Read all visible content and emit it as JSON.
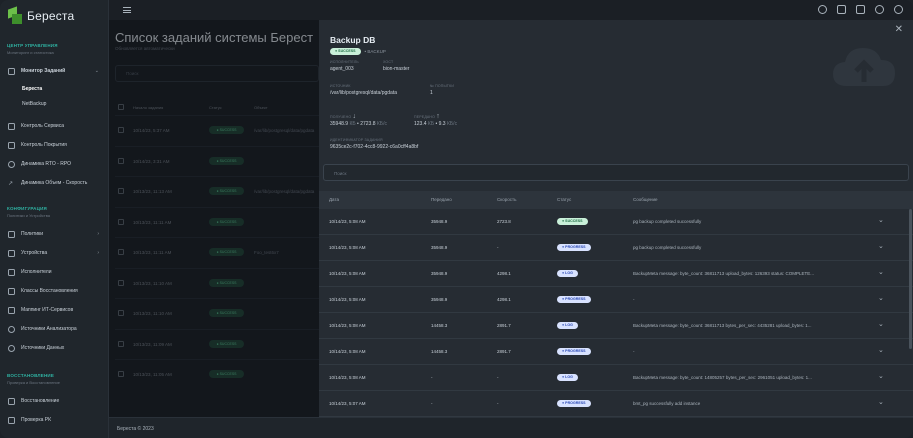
{
  "app": {
    "name": "Береста",
    "footer": "Береста © 2023"
  },
  "sidebar": {
    "sections": [
      {
        "title": "ЦЕНТР УПРАВЛЕНИЯ",
        "subtitle": "Мониторинг и статистика"
      },
      {
        "title": "КОНФИГУРАЦИЯ",
        "subtitle": "Политики и Устройства"
      },
      {
        "title": "ВОССТАНОВЛЕНИЕ",
        "subtitle": "Проверка и Восстановление"
      }
    ],
    "items": [
      {
        "label": "Монитор Заданий",
        "icon": "monitor-icon"
      },
      {
        "label": "Береста",
        "icon": ""
      },
      {
        "label": "NetBackup",
        "icon": ""
      },
      {
        "label": "Контроль Сервиса",
        "icon": "clipboard-icon"
      },
      {
        "label": "Контроль Покрытия",
        "icon": "clipboard-check-icon"
      },
      {
        "label": "Динамика RTO - RPO",
        "icon": "clock-icon"
      },
      {
        "label": "Динамика Объем - Скорость",
        "icon": "trend-icon"
      },
      {
        "label": "Политики",
        "icon": "policy-icon"
      },
      {
        "label": "Устройства",
        "icon": "device-icon"
      },
      {
        "label": "Исполнители",
        "icon": "server-icon"
      },
      {
        "label": "Классы Восстановления",
        "icon": "class-icon"
      },
      {
        "label": "Маппинг ИТ-Сервисов",
        "icon": "mapping-icon"
      },
      {
        "label": "Источники Анализатора",
        "icon": "source-icon"
      },
      {
        "label": "Источники Данных",
        "icon": "database-icon"
      },
      {
        "label": "Восстановление",
        "icon": "restore-icon"
      },
      {
        "label": "Проверка РК",
        "icon": "check-icon"
      }
    ]
  },
  "background": {
    "title": "Список заданий системы Берест",
    "subtitle": "Обновляется автоматически",
    "search_placeholder": "Поиск",
    "headers": [
      "Начало задания",
      "Статус",
      "Объект"
    ],
    "rows": [
      {
        "date": "10/14/23, 5:37 AM",
        "status": "SUCCESS",
        "object": "/var/lib/postgresql/data/pgdata"
      },
      {
        "date": "10/14/23, 3:31 AM",
        "status": "SUCCESS",
        "object": ""
      },
      {
        "date": "10/13/23, 11:13 AM",
        "status": "SUCCESS",
        "object": "/var/lib/postgresql/data/pgdata"
      },
      {
        "date": "10/13/23, 11:11 AM",
        "status": "SUCCESS",
        "object": ""
      },
      {
        "date": "10/13/23, 11:11 AM",
        "status": "SUCCESS",
        "object": "Foo_test6x7"
      },
      {
        "date": "10/13/23, 11:10 AM",
        "status": "SUCCESS",
        "object": ""
      },
      {
        "date": "10/13/23, 11:10 AM",
        "status": "SUCCESS",
        "object": ""
      },
      {
        "date": "10/13/23, 11:09 AM",
        "status": "SUCCESS",
        "object": ""
      },
      {
        "date": "10/13/23, 11:05 AM",
        "status": "SUCCESS",
        "object": ""
      }
    ]
  },
  "drawer": {
    "title": "Backup DB",
    "status": "SUCCESS",
    "type": "BACKUP",
    "executor_label": "ИСПОЛНИТЕЛЬ",
    "executor": "agent_003",
    "host_label": "ХОСТ",
    "host": "bion-master",
    "source_label": "ИСТОЧНИК",
    "source": "/var/lib/postgresql/data/pgdata",
    "attempts_label": "№ ПОПЫТКИ",
    "attempts": "1",
    "processed_label": "ПОЛУЧЕНО",
    "processed": "35948.9",
    "processed_unit": "КБ",
    "processed_speed": "2723.8",
    "processed_speed_unit": "КБ/с",
    "transferred_label": "ПЕРЕДАНО",
    "transferred": "123.4",
    "transferred_unit": "КБ",
    "transferred_speed": "9.3",
    "transferred_speed_unit": "КБ/с",
    "job_id_label": "ИДЕНТИФИКАТОР ЗАДАНИЯ",
    "job_id": "9635ce2c-f702-4cc8-9922-c6a0cff4a8bf",
    "search_placeholder": "Поиск",
    "columns": [
      "Дата",
      "Передано",
      "Скорость",
      "Статус",
      "Сообщение"
    ],
    "rows": [
      {
        "date": "10/14/23, 5:08 AM",
        "transferred": "35948.9",
        "speed": "2723.8",
        "status": "SUCCESS",
        "message": "pg backup completed successfully"
      },
      {
        "date": "10/14/23, 5:08 AM",
        "transferred": "35948.9",
        "speed": "-",
        "status": "PROGRESS",
        "message": "pg backup completed successfully"
      },
      {
        "date": "10/14/23, 5:08 AM",
        "transferred": "35948.9",
        "speed": "4298.1",
        "status": "LOG",
        "message": "BackupMeta message: byte_count: 36811713 upload_bytes: 126393 status: COMPLETE..."
      },
      {
        "date": "10/14/23, 5:08 AM",
        "transferred": "35948.9",
        "speed": "4298.1",
        "status": "PROGRESS",
        "message": "-"
      },
      {
        "date": "10/14/23, 5:08 AM",
        "transferred": "14458.3",
        "speed": "2891.7",
        "status": "LOG",
        "message": "BackupMeta message: byte_count: 36811713 bytes_per_sec: 4435281 upload_bytes: 1..."
      },
      {
        "date": "10/14/23, 5:08 AM",
        "transferred": "14458.3",
        "speed": "2891.7",
        "status": "PROGRESS",
        "message": "-"
      },
      {
        "date": "10/14/23, 5:08 AM",
        "transferred": "-",
        "speed": "-",
        "status": "LOG",
        "message": "BackupMeta message: byte_count: 14805257 bytes_per_sec: 2961051 upload_bytes: 1..."
      },
      {
        "date": "10/14/23, 5:07 AM",
        "transferred": "-",
        "speed": "-",
        "status": "PROGRESS",
        "message": "bmt_pg successfully add instance"
      }
    ]
  }
}
